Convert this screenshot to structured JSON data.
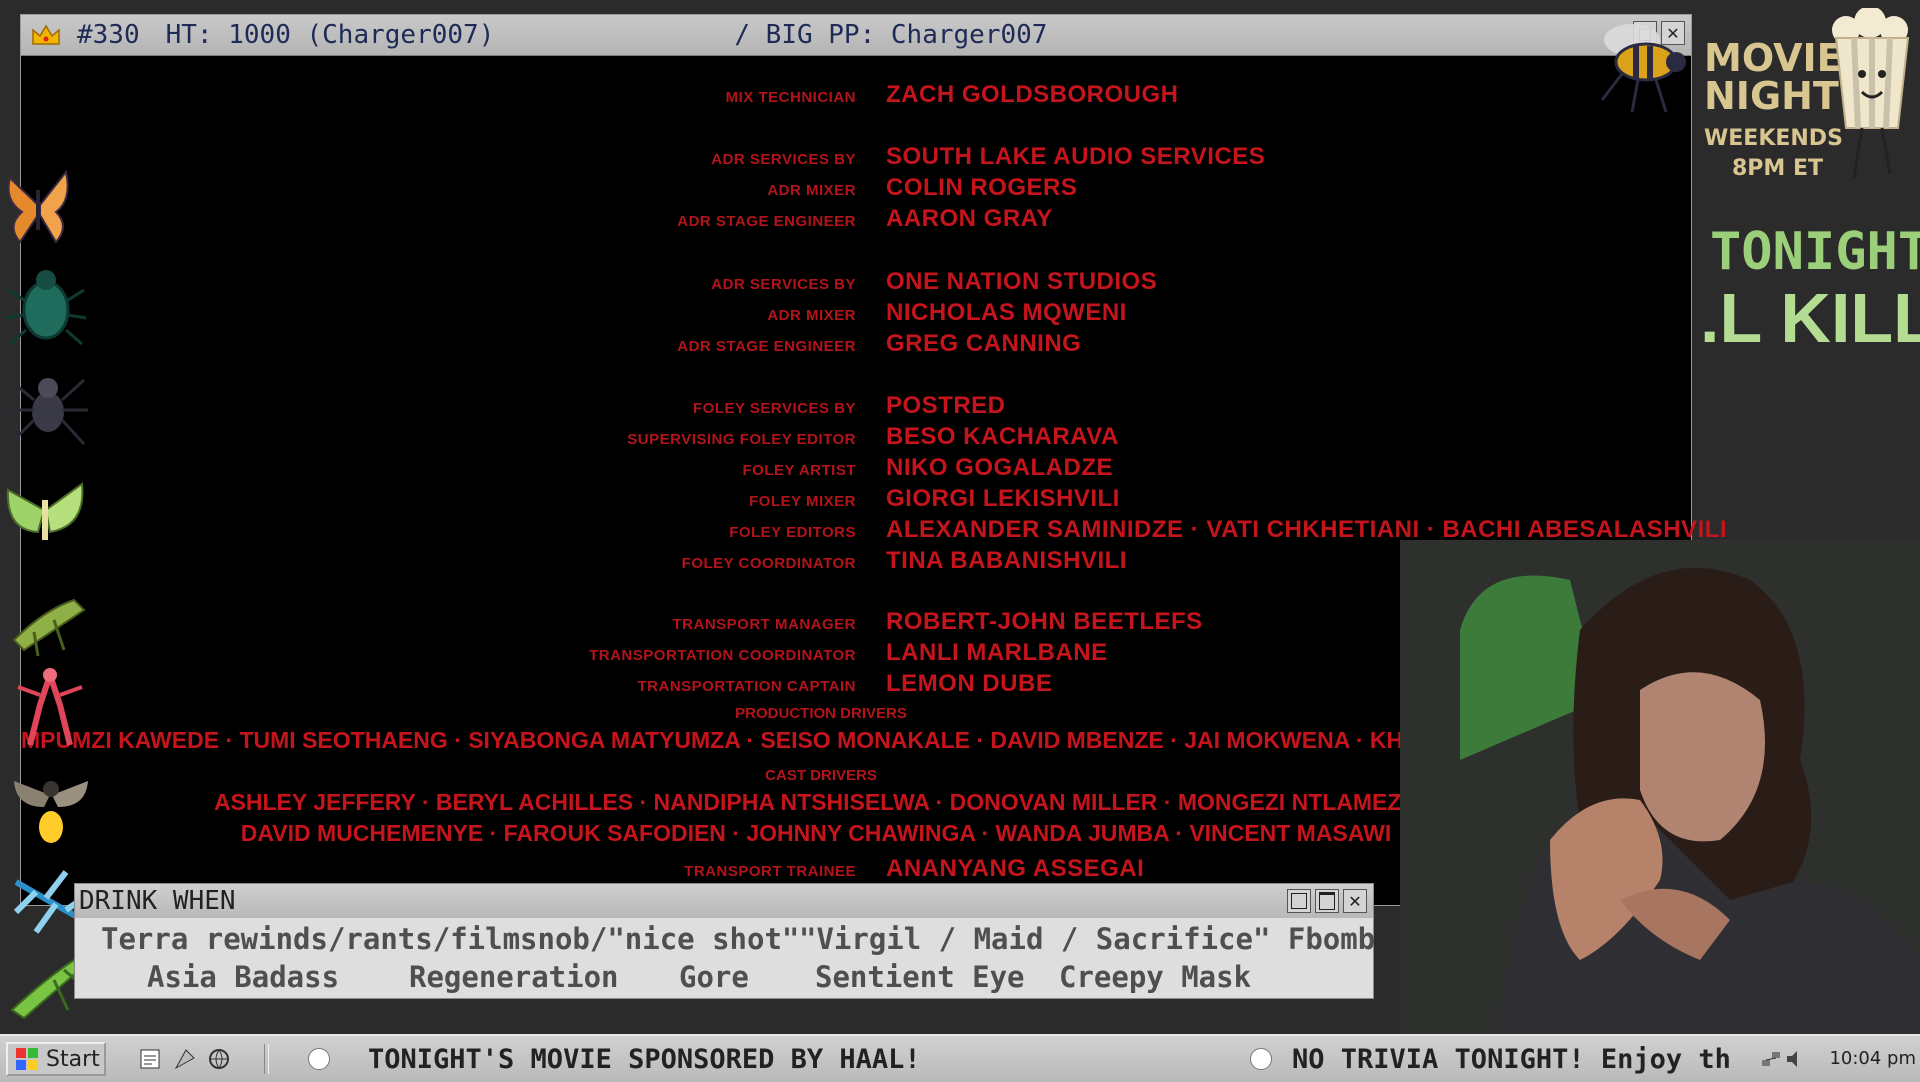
{
  "window": {
    "title_rank": "#330",
    "title_ht": "HT: 1000 (Charger007)",
    "title_bigpp": "/ BIG PP: Charger007",
    "controls": [
      "□",
      "✕"
    ]
  },
  "credits": {
    "rows": [
      {
        "role": "Mix Technician",
        "name": "Zach Goldsborough"
      },
      {
        "role": "ADR Services by",
        "name": "South Lake Audio Services"
      },
      {
        "role": "ADR Mixer",
        "name": "Colin Rogers"
      },
      {
        "role": "ADR Stage Engineer",
        "name": "Aaron Gray"
      },
      {
        "role": "ADR Services by",
        "name": "One Nation Studios"
      },
      {
        "role": "ADR Mixer",
        "name": "Nicholas Mqweni"
      },
      {
        "role": "ADR Stage Engineer",
        "name": "Greg Canning"
      },
      {
        "role": "Foley Services by",
        "name": "Postred"
      },
      {
        "role": "Supervising Foley Editor",
        "name": "Beso Kacharava"
      },
      {
        "role": "Foley Artist",
        "name": "Niko Gogaladze"
      },
      {
        "role": "Foley Mixer",
        "name": "Giorgi Lekishvili"
      },
      {
        "role": "Foley Editors",
        "name": "Alexander Saminidze · Vati Chkhetiani · Bachi Abesalashvili"
      },
      {
        "role": "Foley Coordinator",
        "name": "Tina Babanishvili"
      },
      {
        "role": "Transport Manager",
        "name": "Robert-John Beetlefs"
      },
      {
        "role": "Transportation Coordinator",
        "name": "Lanli Marlbane"
      },
      {
        "role": "Transportation Captain",
        "name": "Lemon Dube"
      }
    ],
    "production_drivers_label": "Production Drivers",
    "production_drivers": "Mpumzi Kawede · Tumi Seothaeng · Siyabonga Matyumza · Seiso Monakale · David Mbenze · Jai Mokwena · Khaya Woko · Kurt De Villiers",
    "cast_drivers_label": "Cast Drivers",
    "cast_drivers_1": "Ashley Jeffery · Beryl Achilles · Nandipha Ntshiselwa · Donovan Miller · Mongezi Ntlameza",
    "cast_drivers_2": "David Muchemenye · Farouk Safodien · Johnny Chawinga · Wanda Jumba · Vincent Masawi",
    "last_row": {
      "role": "Transport Trainee",
      "name": "Ananyang Assegai"
    }
  },
  "drink_panel": {
    "title": "DRINK WHEN",
    "items": [
      "Terra rewinds/rants/filmsnob/\"nice shot\"",
      "\"Virgil / Maid / Sacrifice\" Fbomb",
      "Asia Badass",
      "Regeneration",
      "Gore",
      "Sentient Eye",
      "Creepy Mask"
    ]
  },
  "taskbar": {
    "start_label": "Start",
    "ticker_1": "TONIGHT'S MOVIE SPONSORED BY HAAL!",
    "ticker_2": "NO TRIVIA TONIGHT! Enjoy th",
    "clock": "10:04 pm"
  },
  "right_panel": {
    "movie": "MOVIE",
    "night": "NIGHT",
    "weekends": "WEEKENDS",
    "time": "8PM ET",
    "tonight": "TONIGHT:",
    "kill": ".L KILL"
  },
  "colors": {
    "credit_red": "#c5141c",
    "tonight_green": "#9bcf7a",
    "movie_night_gold": "#d9c58f"
  }
}
